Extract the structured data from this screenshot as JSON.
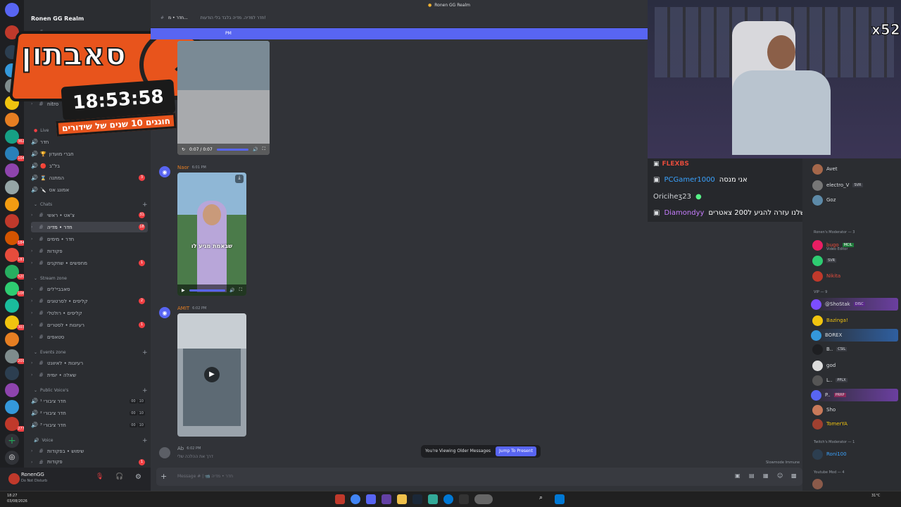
{
  "server": {
    "name": "Ronen GG Realm",
    "rail_badges": [
      "362",
      "104",
      "184",
      "181",
      "520",
      "106",
      "303",
      "209",
      "277"
    ]
  },
  "overlay": {
    "logo_text": "סאבתון",
    "timer": "18:53:58",
    "subtitle": "חוגגים 10 שנים של שידורים",
    "multiplier": "x52"
  },
  "sidebar": {
    "top_items": [
      {
        "label": "עדכונים",
        "icon": "#"
      },
      {
        "label": "nitro",
        "icon": "#"
      }
    ],
    "categories": [
      {
        "name": "Live",
        "channels": [
          {
            "label": "חדר",
            "type": "voice",
            "emoji": "🔴"
          },
          {
            "label": "חברי מועדון",
            "type": "voice",
            "emoji": "🏆"
          },
          {
            "label": "בל\"ב",
            "type": "voice",
            "emoji": "🔴"
          },
          {
            "label": "המתנה",
            "type": "voice",
            "emoji": "⌛",
            "badge": "3"
          },
          {
            "label": "אמונג אס",
            "type": "voice",
            "emoji": "🔪"
          }
        ]
      },
      {
        "name": "Chats",
        "channels": [
          {
            "label": "צ'אט • ראשי",
            "type": "text",
            "badge": "31"
          },
          {
            "label": "חדר • מדיה",
            "type": "text",
            "badge": "18",
            "active": true
          },
          {
            "label": "חדר • מימים",
            "type": "text"
          },
          {
            "label": "פקודות",
            "type": "text"
          },
          {
            "label": "מחפשים • שחקנים",
            "type": "text",
            "badge": "1"
          }
        ]
      },
      {
        "name": "Stream zone",
        "channels": [
          {
            "label": "סאבביי'לים",
            "type": "text"
          },
          {
            "label": "קליפים • לסרטונים",
            "type": "text",
            "badge": "2"
          },
          {
            "label": "קליפים • רולטלי",
            "type": "text"
          },
          {
            "label": "רעיונות • לסטרים",
            "type": "text",
            "badge": "1"
          },
          {
            "label": "סטאפים",
            "type": "text"
          }
        ]
      },
      {
        "name": "Events zone",
        "channels": [
          {
            "label": "רעיונות • לאיוונט",
            "type": "text"
          },
          {
            "label": "שאלה • יומית",
            "type": "text"
          }
        ]
      },
      {
        "name": "Public Voice's",
        "channels": [
          {
            "label": "חדר ציבורי ¹",
            "type": "voice",
            "vc": [
              "00",
              "10"
            ]
          },
          {
            "label": "חדר ציבורי ²",
            "type": "voice",
            "vc": [
              "00",
              "10"
            ]
          },
          {
            "label": "חדר ציבורי ³",
            "type": "voice",
            "vc": [
              "00",
              "10"
            ]
          }
        ]
      },
      {
        "name": "Voice",
        "channels": [
          {
            "label": "שימוש • בפקודות",
            "type": "text"
          },
          {
            "label": "פקודות",
            "type": "text",
            "badge": "1"
          }
        ]
      }
    ]
  },
  "user": {
    "name": "RonenGG",
    "status": "Do Not Disturb"
  },
  "topbar": {
    "channel": "חדר • מ...",
    "topic": "חדר למדיה. מדיה בלבד בלי הודעות!",
    "window_title": "Ronen GG Realm"
  },
  "banner": {
    "text": "PM"
  },
  "messages": [
    {
      "author": "Naor",
      "time": "6:01 PM",
      "author_color": "#e67e22",
      "caption": "שבאמת מגיע לו"
    },
    {
      "author": "AMIT",
      "time": "6:02 PM",
      "author_color": "#e67e22"
    },
    {
      "author": "Ab",
      "time": "6:02 PM",
      "author_color": "#9aa0a6",
      "text": "דרך את ההלכה שלי"
    }
  ],
  "first_video": {
    "time": "0:07 / 0:07"
  },
  "older_messages": {
    "text": "You're Viewing Older Messages",
    "button": "Jump To Present"
  },
  "slowmode": "Slowmode Immune",
  "composer": {
    "placeholder": "Message # | 📹 חדר • מדיה"
  },
  "overlay_chat": [
    {
      "user": "FLEXBS",
      "color": "#e74c3c",
      "text": ""
    },
    {
      "user": "PCGamer1000",
      "color": "#3aa3ff",
      "text": "אני מנסה"
    },
    {
      "user": "Oriciheʒ23",
      "color": "#cfd2d6",
      "text": ""
    },
    {
      "user": "Diamondyy",
      "color": "#c77dff",
      "text": "רוב המנויים שלנו עזרה להגיע ל200 צאטרים"
    }
  ],
  "members": {
    "groups": [
      {
        "label": "Ronen's Moderator — 3"
      },
      {
        "label": "VIP — 9"
      },
      {
        "label": "Twitch's Moderator — 1"
      },
      {
        "label": "Youtube Mod — 4"
      }
    ],
    "top": [
      {
        "name": "Avet",
        "color": "#dbdee1"
      },
      {
        "name": "electro_V",
        "color": "#dbdee1",
        "tag": "SVR"
      },
      {
        "name": "Goz",
        "color": "#dbdee1"
      }
    ],
    "mods": [
      {
        "name": "bugo",
        "color": "#e74c3c",
        "tag": "MCIL",
        "sub": "Video Editor"
      },
      {
        "name": "",
        "color": "#e74c3c",
        "tag": "SVR"
      },
      {
        "name": "Nikita",
        "color": "#e74c3c"
      }
    ],
    "vips": [
      {
        "name": "@ShoStak",
        "color": "#dbdee1",
        "tag": "DISC"
      },
      {
        "name": "Bazinga!",
        "color": "#f1c40f"
      },
      {
        "name": "BOREX",
        "color": "#dbdee1"
      },
      {
        "name": "B..",
        "color": "#dbdee1",
        "tag": "CSIL"
      },
      {
        "name": "god",
        "color": "#dbdee1"
      },
      {
        "name": "L..",
        "color": "#dbdee1",
        "tag": "PPLX"
      },
      {
        "name": "P..",
        "color": "#dbdee1",
        "tag": "PRRP"
      },
      {
        "name": "Sho",
        "color": "#dbdee1"
      },
      {
        "name": "TomerYA",
        "color": "#f1c40f"
      }
    ],
    "twitch": [
      {
        "name": "Roni100",
        "color": "#3aa3ff"
      }
    ]
  },
  "taskbar": {
    "time": "18:27",
    "date": "03/08/2026",
    "temp": "31°C"
  }
}
